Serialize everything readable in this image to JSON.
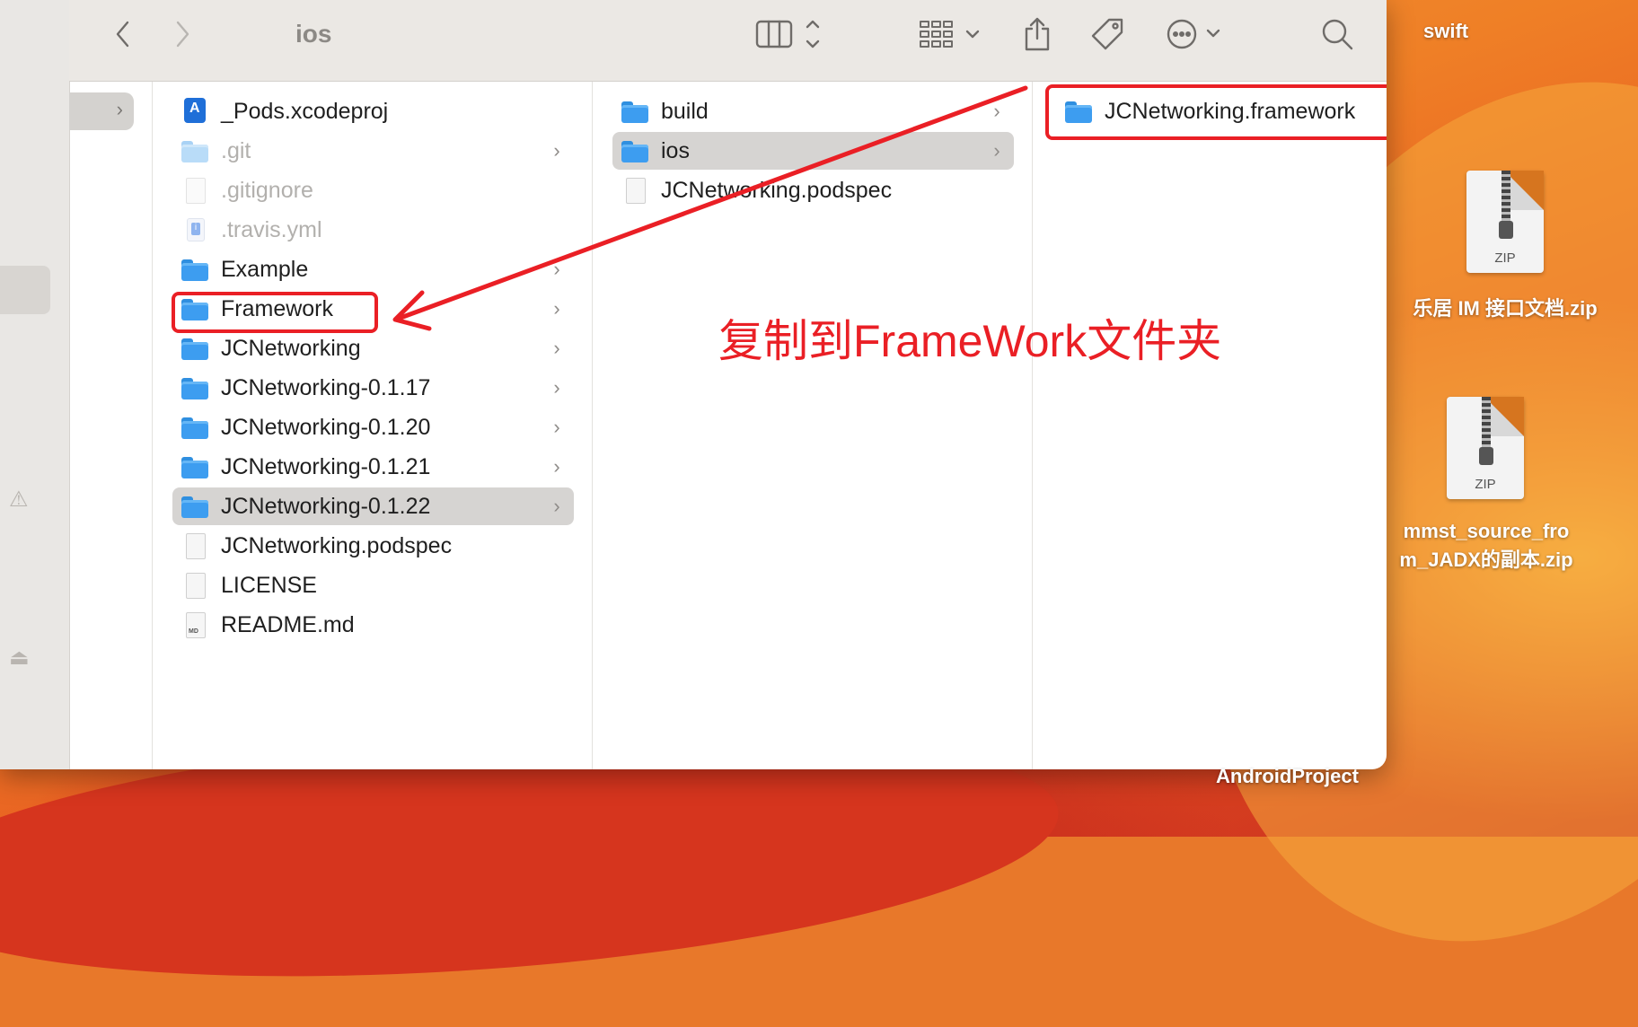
{
  "window": {
    "title": "ios"
  },
  "toolbar": {
    "back": "back-chevron-icon",
    "forward": "forward-chevron-icon",
    "view": "column-view-icon",
    "group": "group-grid-icon",
    "share": "share-icon",
    "tags": "tag-icon",
    "more": "ellipsis-circle-icon",
    "search": "search-icon"
  },
  "column1": {
    "items": [
      {
        "name": "_Pods.xcodeproj"
      },
      {
        "name": ".git"
      },
      {
        "name": ".gitignore"
      },
      {
        "name": ".travis.yml"
      },
      {
        "name": "Example"
      },
      {
        "name": "Framework"
      },
      {
        "name": "JCNetworking"
      },
      {
        "name": "JCNetworking-0.1.17"
      },
      {
        "name": "JCNetworking-0.1.20"
      },
      {
        "name": "JCNetworking-0.1.21"
      },
      {
        "name": "JCNetworking-0.1.22"
      },
      {
        "name": "JCNetworking.podspec"
      },
      {
        "name": "LICENSE"
      },
      {
        "name": "README.md"
      }
    ]
  },
  "column2": {
    "items": [
      {
        "name": "build"
      },
      {
        "name": "ios"
      },
      {
        "name": "JCNetworking.podspec"
      }
    ]
  },
  "column3": {
    "items": [
      {
        "name": "JCNetworking.framework"
      }
    ]
  },
  "annotation": {
    "text": "复制到FrameWork文件夹",
    "color": "#ea1f25"
  },
  "desktop": {
    "top_label": "swift",
    "zip1_badge": "ZIP",
    "zip1_label": "乐居 IM 接口文档.zip",
    "zip2_badge": "ZIP",
    "zip2_label_line1": "mmst_source_fro",
    "zip2_label_line2": "m_JADX的副本.zip",
    "bottom_label": "AndroidProject"
  }
}
